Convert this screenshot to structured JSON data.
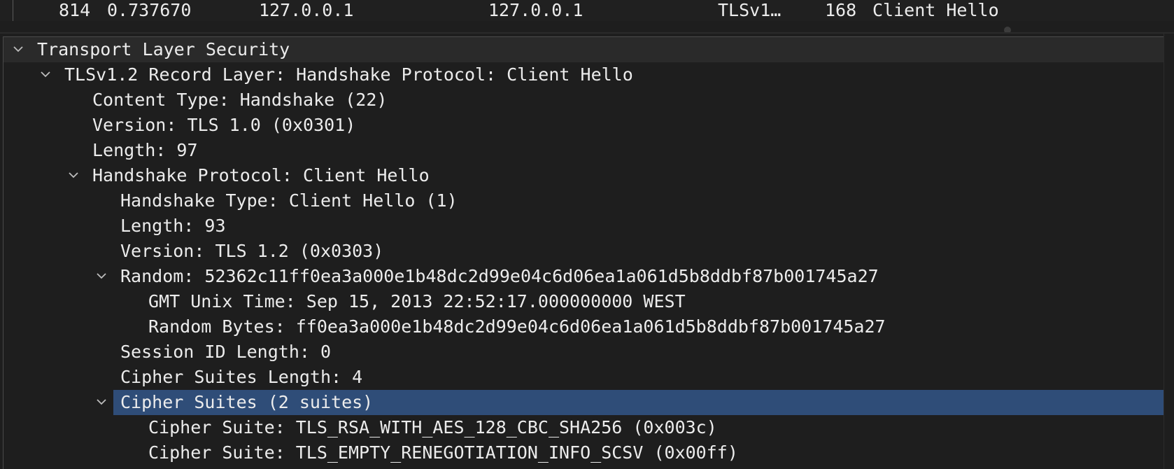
{
  "packet_row": {
    "no": "814",
    "time": "0.737670",
    "source": "127.0.0.1",
    "destination": "127.0.0.1",
    "protocol": "TLSv1…",
    "length": "168",
    "info": "Client Hello"
  },
  "tree": [
    {
      "label": "Transport Layer Security",
      "expanded": true
    },
    {
      "label": "TLSv1.2 Record Layer: Handshake Protocol: Client Hello",
      "expanded": true
    },
    {
      "label": "Content Type: Handshake (22)"
    },
    {
      "label": "Version: TLS 1.0 (0x0301)"
    },
    {
      "label": "Length: 97"
    },
    {
      "label": "Handshake Protocol: Client Hello",
      "expanded": true
    },
    {
      "label": "Handshake Type: Client Hello (1)"
    },
    {
      "label": "Length: 93"
    },
    {
      "label": "Version: TLS 1.2 (0x0303)"
    },
    {
      "label": "Random: 52362c11ff0ea3a000e1b48dc2d99e04c6d06ea1a061d5b8ddbf87b001745a27",
      "expanded": true
    },
    {
      "label": "GMT Unix Time: Sep 15, 2013 22:52:17.000000000 WEST"
    },
    {
      "label": "Random Bytes: ff0ea3a000e1b48dc2d99e04c6d06ea1a061d5b8ddbf87b001745a27"
    },
    {
      "label": "Session ID Length: 0"
    },
    {
      "label": "Cipher Suites Length: 4"
    },
    {
      "label": "Cipher Suites (2 suites)",
      "expanded": true,
      "selected": true
    },
    {
      "label": "Cipher Suite: TLS_RSA_WITH_AES_128_CBC_SHA256 (0x003c)"
    },
    {
      "label": "Cipher Suite: TLS_EMPTY_RENEGOTIATION_INFO_SCSV (0x00ff)"
    }
  ],
  "colors": {
    "background": "#1e1e1e",
    "selection": "#2f4d78",
    "text": "#ececec"
  }
}
